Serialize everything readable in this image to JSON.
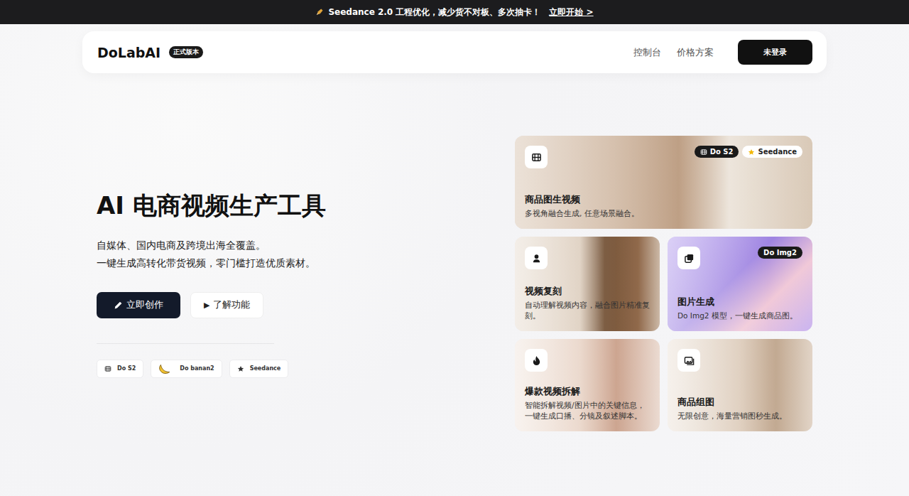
{
  "banner": {
    "text": "Seedance 2.0 工程优化，减少货不对板、多次抽卡！",
    "link": "立即开始 >"
  },
  "nav": {
    "logo": "DoLabAI",
    "badge": "正式版本",
    "links": [
      "控制台",
      "价格方案"
    ],
    "login": "未登录"
  },
  "hero": {
    "title": "AI 电商视频生产工具",
    "subtitle": [
      "自媒体、国内电商及跨境出海全覆盖。",
      "一键生成高转化带货视频，零门槛打造优质素材。"
    ],
    "buttons": [
      {
        "label": "立即创作",
        "kind": "primary",
        "glyph": ""
      },
      {
        "label": "了解功能",
        "kind": "secondary",
        "glyph": "▶"
      }
    ]
  },
  "models": [
    {
      "label": "Do S2",
      "kind": "film"
    },
    {
      "label": "Do banan2",
      "kind": "banana"
    },
    {
      "label": "Seedance",
      "kind": "star"
    }
  ],
  "features": [
    {
      "title": "商品图生视频",
      "desc": "多视角融合生成, 任意场景融合。",
      "kind": "film",
      "badges": [
        {
          "label": "Do S2",
          "kind": "film"
        },
        {
          "label": "Seedance",
          "kind": "star"
        }
      ]
    },
    {
      "title": "视频复刻",
      "desc": "自动理解视频内容，融合图片精准复刻。",
      "kind": "person",
      "badges": []
    },
    {
      "title": "图片生成",
      "desc": "Do Img2 模型，一键生成商品图。",
      "kind": "copy",
      "badges": [
        {
          "label": "Do Img2",
          "kind": "plain"
        }
      ]
    },
    {
      "title": "爆款视频拆解",
      "desc": "智能拆解视频/图片中的关键信息，一键生成口播、分镜及叙述脚本。",
      "kind": "fire",
      "badges": []
    },
    {
      "title": "商品组图",
      "desc": "无限创意，海量营销图秒生成。",
      "kind": "images",
      "badges": []
    }
  ]
}
